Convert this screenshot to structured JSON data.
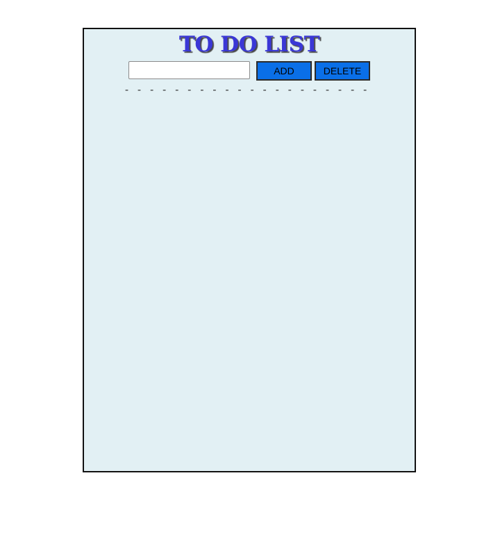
{
  "app": {
    "title": "TO DO LIST"
  },
  "input": {
    "value": "",
    "placeholder": ""
  },
  "buttons": {
    "add_label": "ADD",
    "delete_label": "DELETE"
  },
  "divider": {
    "text": "- - - - - - - - - - - - - - - - - - - - - - - - - - - - - -"
  },
  "todo_items": [],
  "colors": {
    "panel_background": "#e2f0f4",
    "title_color": "#3a37d6",
    "button_color": "#0a6fe8"
  }
}
